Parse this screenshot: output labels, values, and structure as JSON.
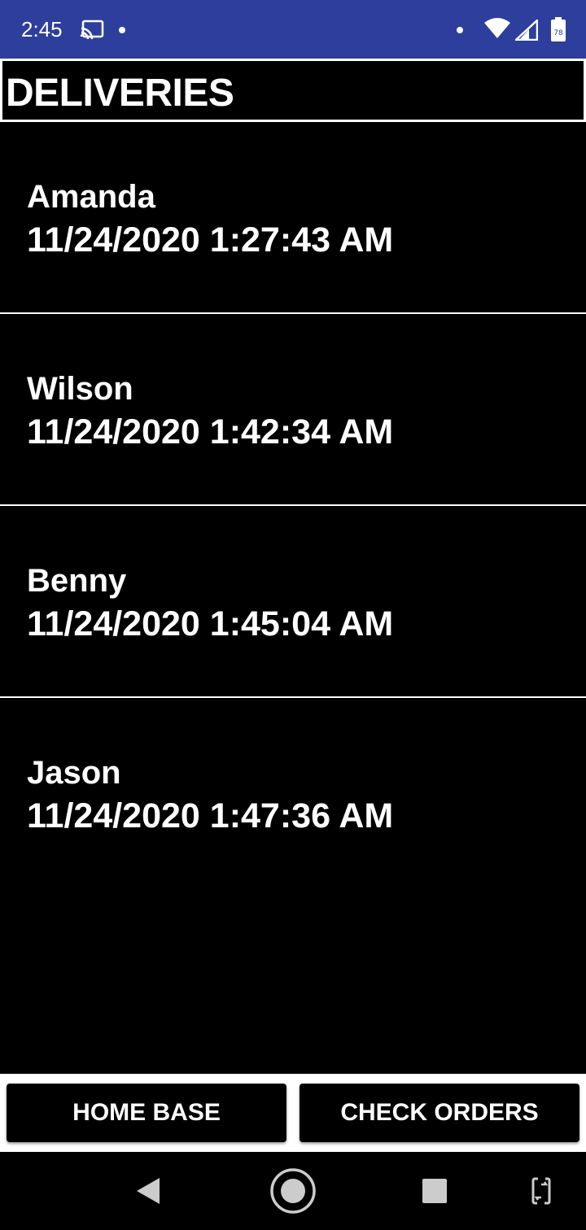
{
  "status_bar": {
    "time": "2:45",
    "icons": [
      "cast-icon",
      "notification-dot",
      "wifi-icon",
      "signal-icon",
      "battery-icon"
    ],
    "battery_text": "78"
  },
  "header": {
    "title": "DELIVERIES"
  },
  "deliveries": [
    {
      "name": "Amanda",
      "timestamp": "11/24/2020 1:27:43 AM"
    },
    {
      "name": "Wilson",
      "timestamp": "11/24/2020 1:42:34 AM"
    },
    {
      "name": "Benny",
      "timestamp": "11/24/2020 1:45:04 AM"
    },
    {
      "name": "Jason",
      "timestamp": "11/24/2020 1:47:36 AM"
    }
  ],
  "buttons": {
    "home_base": "HOME BASE",
    "check_orders": "CHECK ORDERS"
  },
  "nav_bar": {
    "icons": [
      "back-icon",
      "home-icon",
      "recents-icon",
      "rotate-icon"
    ]
  },
  "colors": {
    "status_bar": "#2e3e9c",
    "background": "#000000",
    "text": "#ffffff"
  }
}
